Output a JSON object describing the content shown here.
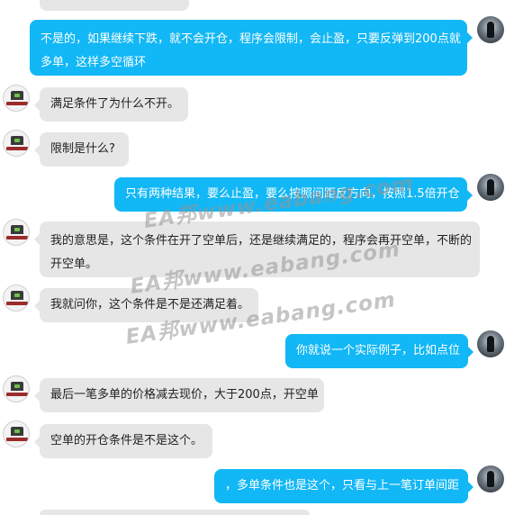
{
  "watermark": "EA邦www.eabang.com",
  "messages": [
    {
      "side": "right",
      "text": "不是的，如果继续下跌，就不会开仓，程序会限制，会止盈，只要反弹到200点就多单，这样多空循环"
    },
    {
      "side": "left",
      "text": "满足条件了为什么不开。"
    },
    {
      "side": "left",
      "text": "限制是什么?"
    },
    {
      "side": "right",
      "text": "只有两种结果，要么止盈，要么按照间距反方向，按照1.5倍开仓"
    },
    {
      "side": "left",
      "text": "我的意思是，这个条件在开了空单后，还是继续满足的，程序会再开空单，不断的开空单。"
    },
    {
      "side": "left",
      "text": "我就问你，这个条件是不是还满足着。"
    },
    {
      "side": "right",
      "text": "你就说一个实际例子，比如点位"
    },
    {
      "side": "left",
      "text": "最后一笔多单的价格减去现价，大于200点，开空单"
    },
    {
      "side": "left",
      "text": "空单的开仓条件是不是这个。"
    },
    {
      "side": "right",
      "text": "，多单条件也是这个，只看与上一笔订单间距"
    }
  ],
  "msg0_l1": "不是的，如果继续下跌，就不会开仓，程序会限制，会止盈，只要反弹到200点就",
  "msg0_l2": "多单，这样多空循环",
  "msg4_l1": "我的意思是，这个条件在开了空单后，还是继续满足的，程序会再开空单，不断的",
  "msg4_l2": "开空单。"
}
